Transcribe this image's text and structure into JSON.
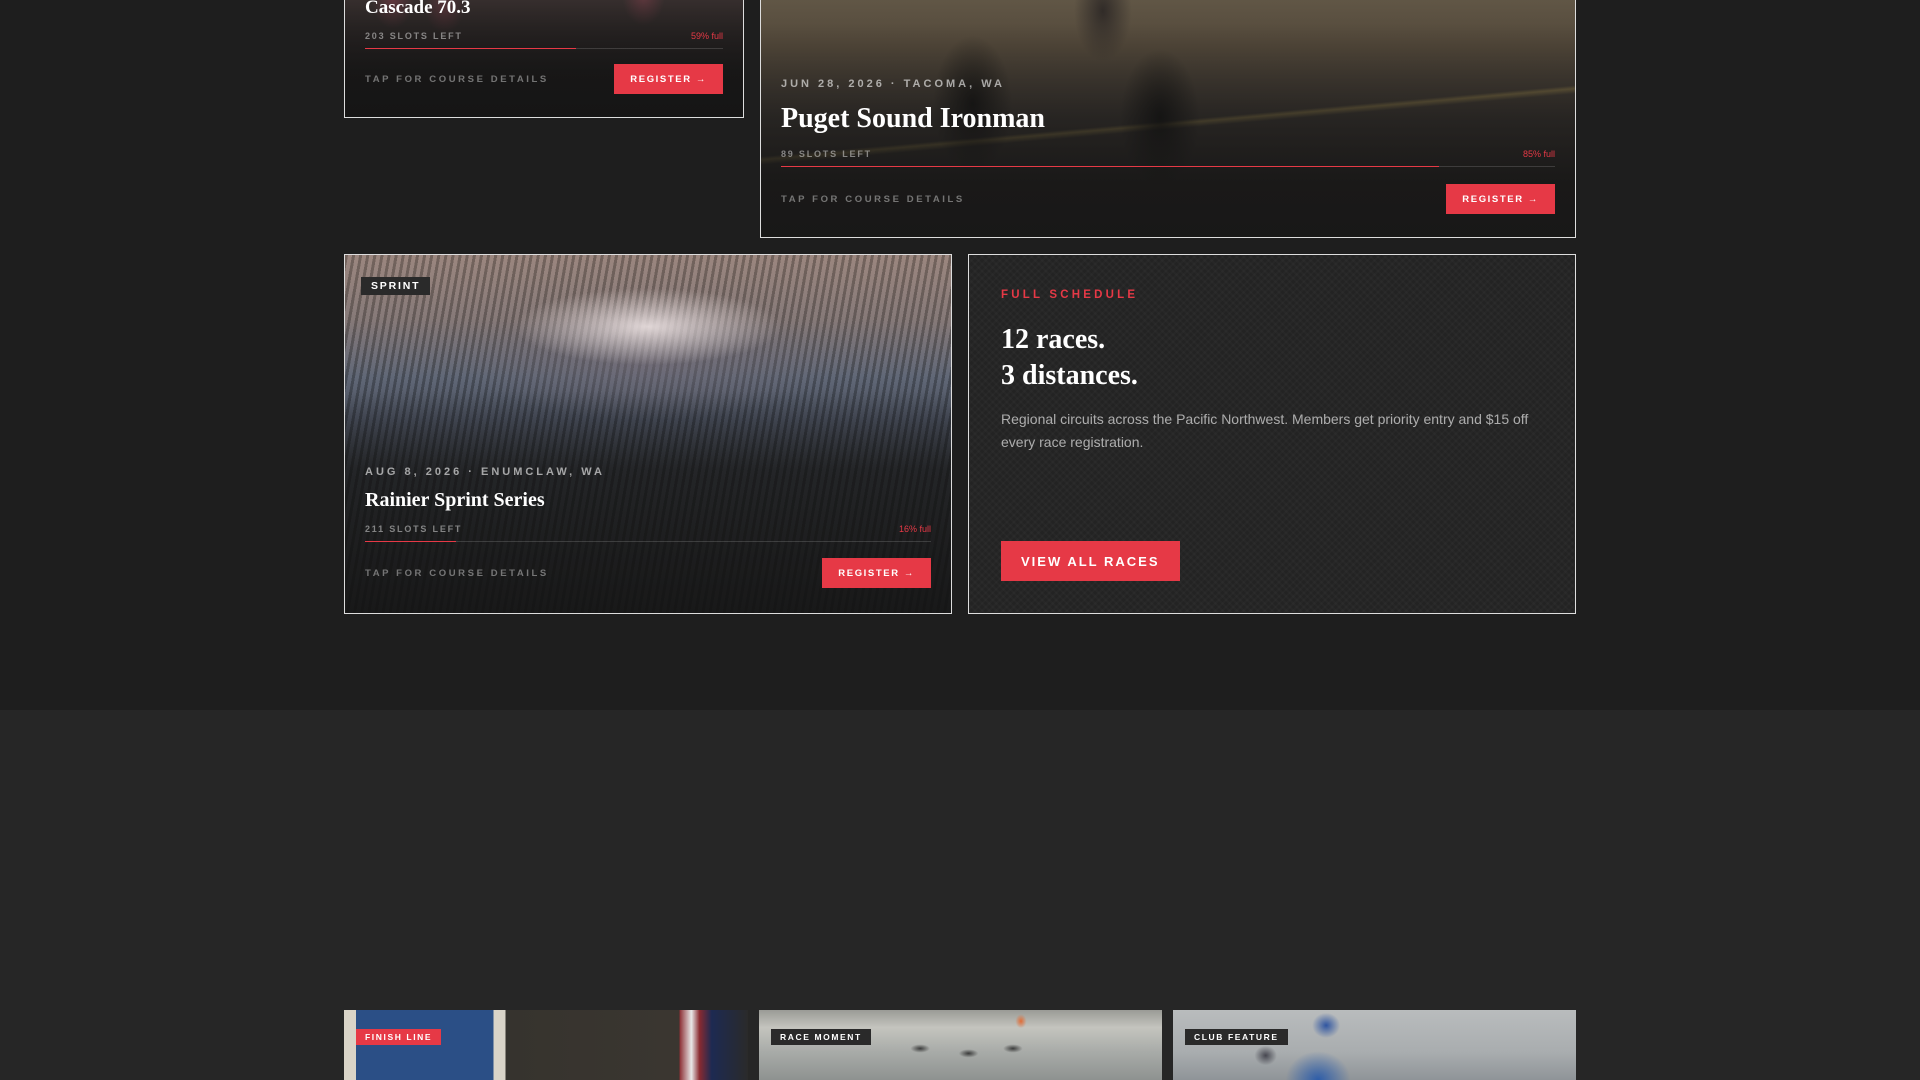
{
  "races": [
    {
      "title": "Cascade 70.3",
      "slots": "203 SLOTS LEFT",
      "percent": "59% full",
      "fill": 0.59,
      "tap": "TAP FOR COURSE DETAILS",
      "register": "REGISTER →"
    },
    {
      "meta": "JUN 28, 2026 · TACOMA, WA",
      "title": "Puget Sound Ironman",
      "slots": "89 SLOTS LEFT",
      "percent": "85% full",
      "fill": 0.85,
      "tap": "TAP FOR COURSE DETAILS",
      "register": "REGISTER →"
    },
    {
      "badge": "SPRINT",
      "meta": "AUG 8, 2026 · ENUMCLAW, WA",
      "title": "Rainier Sprint Series",
      "slots": "211 SLOTS LEFT",
      "percent": "16% full",
      "fill": 0.16,
      "tap": "TAP FOR COURSE DETAILS",
      "register": "REGISTER →"
    }
  ],
  "schedule": {
    "eyebrow": "FULL SCHEDULE",
    "headline_line1": "12 races.",
    "headline_line2": "3 distances.",
    "description": "Regional circuits across the Pacific Northwest. Members get priority entry and $15 off every race registration.",
    "cta": "VIEW ALL RACES"
  },
  "gallery": [
    {
      "badge": "FINISH LINE",
      "badge_color": "#e63946"
    },
    {
      "badge": "RACE MOMENT",
      "badge_color": "#2a2a2a"
    },
    {
      "badge": "CLUB FEATURE",
      "badge_color": "#2a2a2a"
    }
  ],
  "colors": {
    "accent": "#e63946",
    "background": "#1e1e1e",
    "section_alt": "#262626"
  }
}
